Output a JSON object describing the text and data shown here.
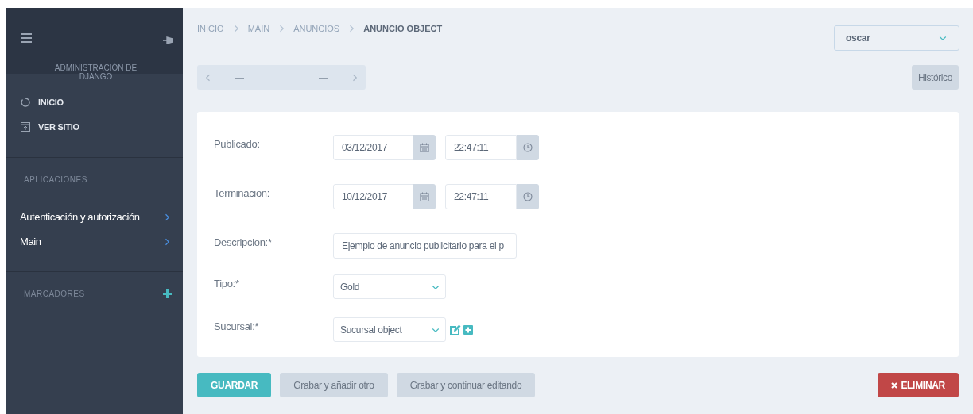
{
  "sidebar": {
    "title": "ADMINISTRACIÓN DE DJANGO",
    "links": [
      {
        "label": "INICIO"
      },
      {
        "label": "VER SITIO"
      }
    ],
    "apps_heading": "APLICACIONES",
    "apps": [
      {
        "label": "Autenticación y autorización"
      },
      {
        "label": "Main"
      }
    ],
    "bookmarks_heading": "MARCADORES"
  },
  "breadcrumbs": [
    {
      "label": "INICIO",
      "current": false
    },
    {
      "label": "MAIN",
      "current": false
    },
    {
      "label": "ANUNCIOS",
      "current": false
    },
    {
      "label": "ANUNCIO OBJECT",
      "current": true
    }
  ],
  "user_menu": {
    "value": "oscar"
  },
  "object_nav": {
    "previous": "—",
    "next": "—"
  },
  "history_button": "Histórico",
  "form": {
    "fields": [
      {
        "kind": "datetime",
        "label": "Publicado:",
        "date": "03/12/2017",
        "time": "22:47:11"
      },
      {
        "kind": "datetime",
        "label": "Terminacion:",
        "date": "10/12/2017",
        "time": "22:47:11"
      },
      {
        "kind": "text",
        "label": "Descripcion:*",
        "value": "Ejemplo de anuncio publicitario para el p"
      },
      {
        "kind": "select",
        "label": "Tipo:*",
        "value": "Gold",
        "related_actions": false
      },
      {
        "kind": "select",
        "label": "Sucursal:*",
        "value": "Sucursal object",
        "related_actions": true
      }
    ]
  },
  "actions": [
    {
      "kind": "primary",
      "label": "GUARDAR"
    },
    {
      "kind": "secondary",
      "label": "Grabar y añadir otro"
    },
    {
      "kind": "secondary",
      "label": "Grabar y continuar editando"
    },
    {
      "kind": "danger",
      "label": "ELIMINAR"
    }
  ]
}
